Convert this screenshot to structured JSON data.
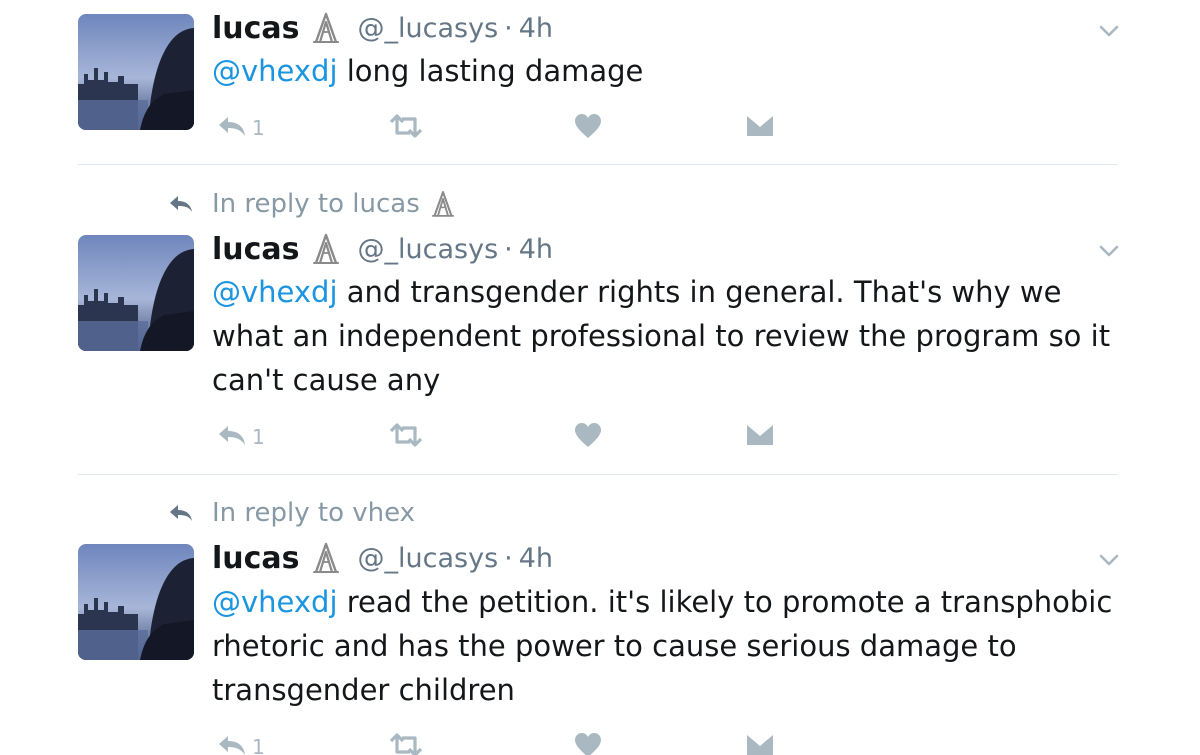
{
  "colors": {
    "mention": "#1b95e0",
    "meta_gray": "#657786",
    "icon_gray": "#aab8c2",
    "divider": "#e1e8ed"
  },
  "icons": {
    "reply": "reply-arrow-icon",
    "retweet": "retweet-icon",
    "like": "heart-icon",
    "dm": "envelope-icon",
    "menu": "chevron-down-icon",
    "name_emoji": "paperclip-emoji-icon"
  },
  "tweets": [
    {
      "name": "lucas",
      "handle": "@_lucasys",
      "separator": "·",
      "time": "4h",
      "mention": "@vhexdj",
      "text": " long lasting damage",
      "reply_count": "1"
    },
    {
      "in_reply_prefix": "In reply to",
      "in_reply_name": "lucas",
      "name": "lucas",
      "handle": "@_lucasys",
      "separator": "·",
      "time": "4h",
      "mention": "@vhexdj",
      "text": " and transgender rights in general. That's why we what an independent professional to review the program so it can't cause any",
      "reply_count": "1"
    },
    {
      "in_reply_prefix": "In reply to",
      "in_reply_name": "vhex",
      "name": "lucas",
      "handle": "@_lucasys",
      "separator": "·",
      "time": "4h",
      "mention": "@vhexdj",
      "text": " read the petition. it's likely to promote a transphobic rhetoric and has the power to cause serious damage to transgender children",
      "reply_count": "1"
    }
  ]
}
